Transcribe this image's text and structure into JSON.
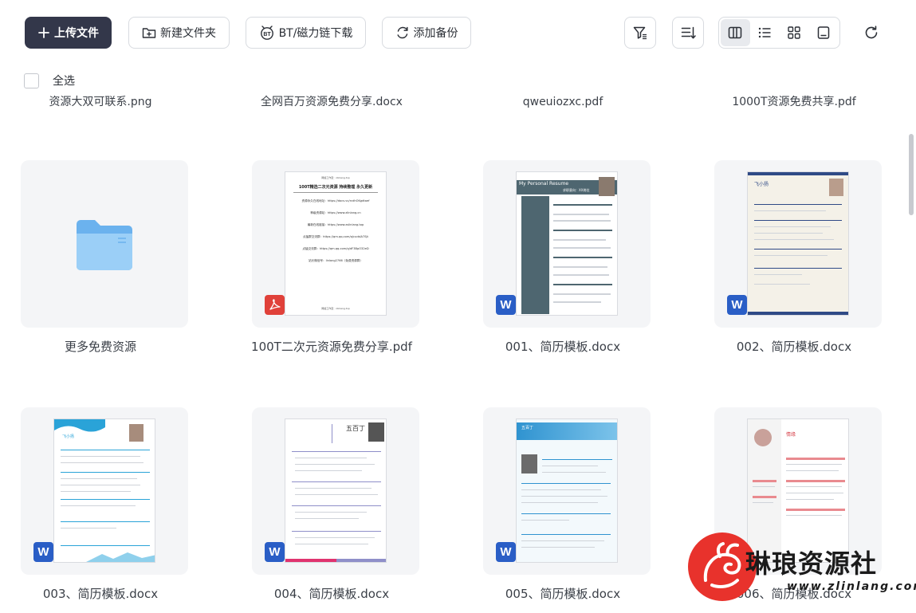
{
  "toolbar": {
    "upload_label": "上传文件",
    "new_folder_label": "新建文件夹",
    "bt_label": "BT/磁力链下载",
    "backup_label": "添加备份",
    "icons": [
      "filter-icon",
      "sort-icon",
      "grid-columns-icon",
      "list-icon",
      "grid-icon",
      "single-view-icon",
      "refresh-icon"
    ]
  },
  "select_all_label": "全选",
  "partial_row": [
    "资源大双可联系.png",
    "全网百万资源免费分享.docx",
    "qweuiozxc.pdf",
    "1000T资源免费共享.pdf"
  ],
  "files": [
    {
      "name": "更多免费资源",
      "type": "folder"
    },
    {
      "name": "100T二次元资源免费分享.pdf",
      "type": "pdf"
    },
    {
      "name": "001、简历模板.docx",
      "type": "docx"
    },
    {
      "name": "002、简历模板.docx",
      "type": "docx"
    },
    {
      "name": "003、简历模板.docx",
      "type": "docx"
    },
    {
      "name": "004、简历模板.docx",
      "type": "docx"
    },
    {
      "name": "005、简历模板.docx",
      "type": "docx"
    },
    {
      "name": "006、简历模板.docx",
      "type": "docx"
    }
  ],
  "pdf_preview": {
    "header": "网络工作室：zlinlang.top",
    "title": "100T精选二次元资源 持续整理 永久更新",
    "lines": [
      "资源永久在线地址：https://docs.vv/rcdhOKgdtaef",
      "神级资源站：https://www.zlinlang.cn",
      "最新在线链接：https://www.zslinlang.top",
      "点猛群交流群：https://qm.qq.com/q/cudsIA7Sjt",
      "点猛交流群：https://qm.qq.com/q/dF3BpO32eD",
      "站长微信号：linlang2766（免费资源群）"
    ],
    "footer": "网络工作室：zlinlang.top"
  },
  "resume_previews": {
    "r001_title": "My Personal Resume",
    "r001_sub": "求职意向：XX岗位",
    "r002_name": "飞小扬",
    "r003_name": "飞小扬",
    "r004_name": "五百丁",
    "r005_name": "五百丁",
    "r006_name": "情缘"
  },
  "watermark": {
    "text": "琳琅资源社",
    "url": "www.zlinlang.com"
  }
}
